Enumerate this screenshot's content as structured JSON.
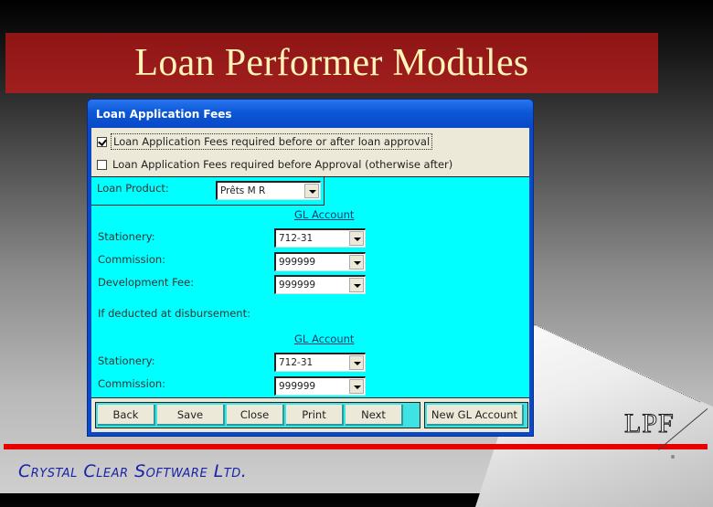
{
  "slide": {
    "title": "Loan Performer Modules",
    "logo_text": "LPF",
    "company": "Crystal Clear Software Ltd.",
    "colors": {
      "title_band": "#9a1a1a",
      "title_text": "#fff3b8",
      "rule": "#e80000",
      "company_text": "#1a23a6"
    }
  },
  "dialog": {
    "caption": "Loan Application Fees",
    "options": [
      {
        "label": "Loan Application Fees required before or after loan approval",
        "checked": true
      },
      {
        "label": "Loan Application Fees required before Approval (otherwise after)",
        "checked": false
      }
    ],
    "loan_product": {
      "label": "Loan Product:",
      "value": "Prêts M R"
    },
    "section1": {
      "gl_header": "GL Account",
      "rows": [
        {
          "label": "Stationery:",
          "value": "712-31"
        },
        {
          "label": "Commission:",
          "value": "999999"
        },
        {
          "label": "Development Fee:",
          "value": "999999"
        }
      ]
    },
    "disbursement_label": "If deducted at disbursement:",
    "section2": {
      "gl_header": "GL Account",
      "rows": [
        {
          "label": "Stationery:",
          "value": "712-31"
        },
        {
          "label": "Commission:",
          "value": "999999"
        }
      ]
    },
    "buttons": [
      "Back",
      "Save",
      "Close",
      "Print",
      "Next"
    ],
    "new_gl_button": "New GL Account",
    "colors": {
      "body": "#00ffff",
      "panel": "#ece9d8",
      "frame": "#0a49c8"
    }
  }
}
